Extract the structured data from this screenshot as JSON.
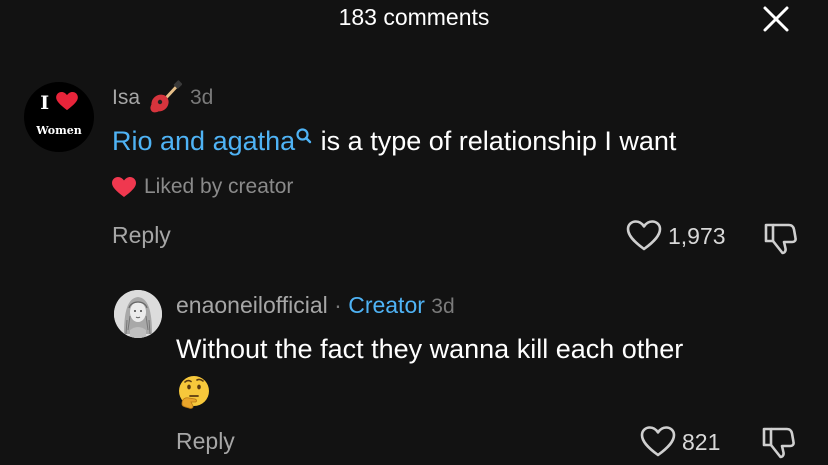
{
  "header": {
    "title": "183 comments"
  },
  "comment": {
    "avatar": {
      "line1_letter": "I",
      "line2": "Women"
    },
    "username": "Isa",
    "timestamp": "3d",
    "mention": "Rio and agatha",
    "text": "is a type of relationship I want",
    "liked_by": "Liked by creator",
    "reply_label": "Reply",
    "like_count": "1,973"
  },
  "reply": {
    "username": "enaoneilofficial",
    "separator": "·",
    "badge": "Creator",
    "timestamp": "3d",
    "text": "Without the fact they wanna kill each other",
    "reply_label": "Reply",
    "like_count": "821"
  },
  "colors": {
    "background": "#121212",
    "mention_blue": "#4fb3f5",
    "heart_red": "#f0384f",
    "muted_text": "#a6a6a6"
  },
  "icons": [
    "close-icon",
    "guitar-emoji-icon",
    "search-icon",
    "heart-icon",
    "heart-outline-icon",
    "dislike-icon",
    "thinking-face-emoji-icon"
  ]
}
